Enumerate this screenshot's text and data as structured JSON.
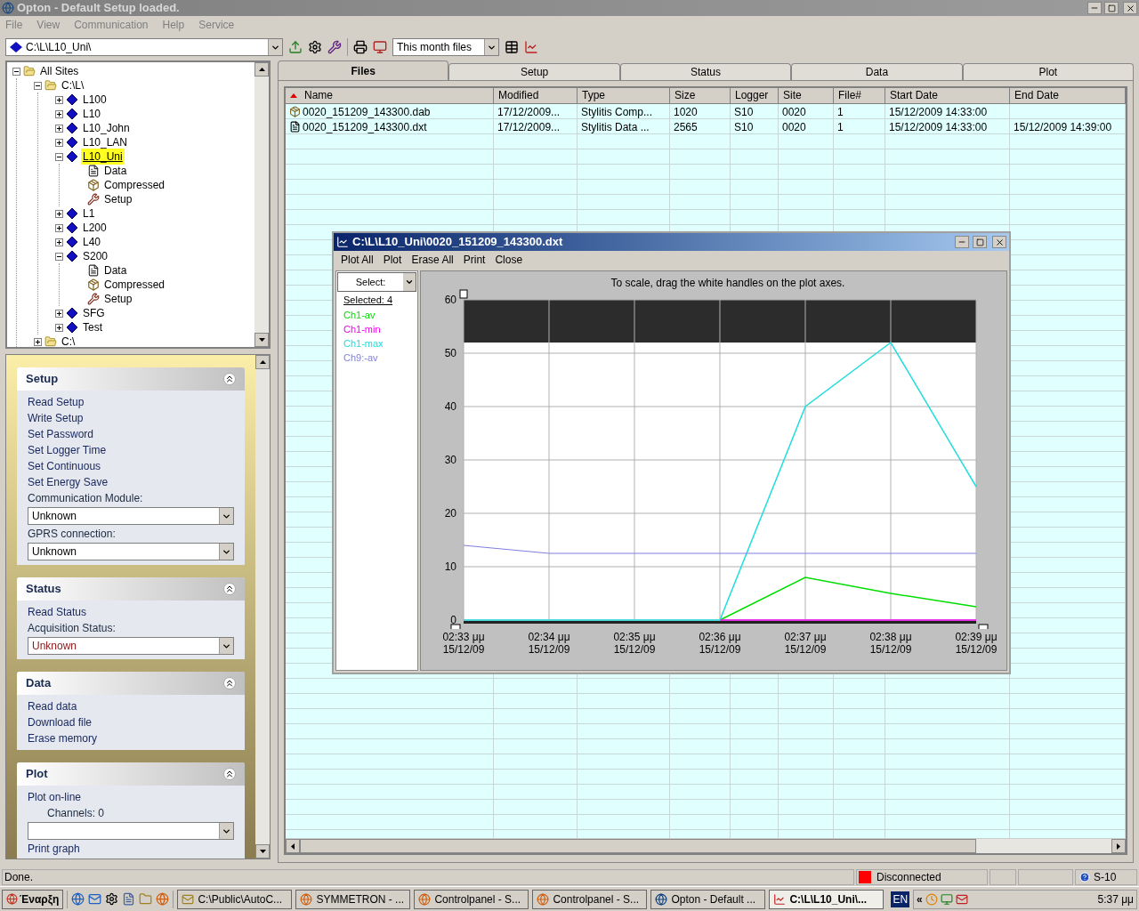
{
  "window": {
    "title": "Opton - Default Setup loaded."
  },
  "menu": [
    "File",
    "View",
    "Communication",
    "Help",
    "Service"
  ],
  "toolbar": {
    "path": "C:\\L\\L10_Uni\\",
    "filter": "This month files"
  },
  "tree": [
    {
      "label": "All Sites",
      "kind": "folder",
      "expanded": true,
      "selected": false,
      "children": [
        {
          "label": "C:\\L\\",
          "kind": "folder",
          "expanded": true,
          "selected": false,
          "children": [
            {
              "label": "L100",
              "kind": "logger",
              "expanded": false,
              "selected": false
            },
            {
              "label": "L10",
              "kind": "logger",
              "expanded": false,
              "selected": false
            },
            {
              "label": "L10_John",
              "kind": "logger",
              "expanded": false,
              "selected": false
            },
            {
              "label": "L10_LAN",
              "kind": "logger",
              "expanded": false,
              "selected": false
            },
            {
              "label": "L10_Uni",
              "kind": "logger",
              "expanded": true,
              "selected": true,
              "children": [
                {
                  "label": "Data",
                  "kind": "data",
                  "selected": false
                },
                {
                  "label": "Compressed",
                  "kind": "compressed",
                  "selected": false
                },
                {
                  "label": "Setup",
                  "kind": "setup",
                  "selected": false
                }
              ]
            },
            {
              "label": "L1",
              "kind": "logger",
              "expanded": false,
              "selected": false
            },
            {
              "label": "L200",
              "kind": "logger",
              "expanded": false,
              "selected": false
            },
            {
              "label": "L40",
              "kind": "logger",
              "expanded": false,
              "selected": false
            },
            {
              "label": "S200",
              "kind": "logger",
              "expanded": true,
              "selected": false,
              "children": [
                {
                  "label": "Data",
                  "kind": "data",
                  "selected": false
                },
                {
                  "label": "Compressed",
                  "kind": "compressed",
                  "selected": false
                },
                {
                  "label": "Setup",
                  "kind": "setup",
                  "selected": false
                }
              ]
            },
            {
              "label": "SFG",
              "kind": "logger",
              "expanded": false,
              "selected": false
            },
            {
              "label": "Test",
              "kind": "logger",
              "expanded": false,
              "selected": false
            }
          ]
        },
        {
          "label": "C:\\",
          "kind": "folder",
          "expanded": false,
          "selected": false
        }
      ]
    }
  ],
  "task_pane": [
    {
      "title": "Setup",
      "items": [
        {
          "kind": "link",
          "text": "Read Setup"
        },
        {
          "kind": "link",
          "text": "Write Setup"
        },
        {
          "kind": "link",
          "text": "Set Password"
        },
        {
          "kind": "link",
          "text": "Set Logger Time"
        },
        {
          "kind": "link",
          "text": "Set Continuous"
        },
        {
          "kind": "link",
          "text": "Set Energy Save"
        },
        {
          "kind": "label",
          "text": "Communication Module:"
        },
        {
          "kind": "dropdown",
          "text": "Unknown",
          "warning": false
        },
        {
          "kind": "label",
          "text": "GPRS connection:"
        },
        {
          "kind": "dropdown",
          "text": "Unknown",
          "warning": false
        }
      ]
    },
    {
      "title": "Status",
      "items": [
        {
          "kind": "link",
          "text": "Read Status"
        },
        {
          "kind": "label",
          "text": "Acquisition Status:"
        },
        {
          "kind": "dropdown",
          "text": "Unknown",
          "warning": true
        }
      ]
    },
    {
      "title": "Data",
      "items": [
        {
          "kind": "link",
          "text": "Read data"
        },
        {
          "kind": "link",
          "text": "Download file"
        },
        {
          "kind": "link",
          "text": "Erase memory"
        }
      ]
    },
    {
      "title": "Plot",
      "items": [
        {
          "kind": "link",
          "text": "Plot on-line"
        },
        {
          "kind": "sublabel",
          "text": "Channels: 0"
        },
        {
          "kind": "empty-dropdown"
        },
        {
          "kind": "link",
          "text": "Print graph"
        }
      ]
    }
  ],
  "tabs": [
    {
      "label": "Files",
      "selected": true
    },
    {
      "label": "Setup",
      "selected": false
    },
    {
      "label": "Status",
      "selected": false
    },
    {
      "label": "Data",
      "selected": false
    },
    {
      "label": "Plot",
      "selected": false
    }
  ],
  "files_table": {
    "columns": [
      "Name",
      "Modified",
      "Type",
      "Size",
      "Logger",
      "Site",
      "File#",
      "Start Date",
      "End Date"
    ],
    "rows": [
      {
        "kind": "compressed",
        "cells": [
          "0020_151209_143300.dab",
          "17/12/2009...",
          "Stylitis Comp...",
          "1020",
          "S10",
          "0020",
          "1",
          "15/12/2009 14:33:00",
          ""
        ]
      },
      {
        "kind": "data",
        "cells": [
          "0020_151209_143300.dxt",
          "17/12/2009...",
          "Stylitis Data ...",
          "2565",
          "S10",
          "0020",
          "1",
          "15/12/2009 14:33:00",
          "15/12/2009 14:39:00"
        ]
      }
    ]
  },
  "plot_window": {
    "title": "C:\\L\\L10_Uni\\0020_151209_143300.dxt",
    "menu": [
      "Plot All",
      "Plot",
      "Erase All",
      "Print",
      "Close"
    ],
    "select_label": "Select:",
    "selected_count": "Selected: 4",
    "hint": "To scale, drag the white handles on the plot axes.",
    "chart_data": {
      "type": "line",
      "categories": [
        "02:33 μμ\n15/12/09",
        "02:34 μμ\n15/12/09",
        "02:35 μμ\n15/12/09",
        "02:36 μμ\n15/12/09",
        "02:37 μμ\n15/12/09",
        "02:38 μμ\n15/12/09",
        "02:39 μμ\n15/12/09"
      ],
      "ylim": [
        0,
        60
      ],
      "grid": true,
      "bands": [
        {
          "axis": "y",
          "from": 52,
          "to": 60,
          "color": "#2c2c2c"
        }
      ],
      "yticks": [
        0,
        10,
        20,
        30,
        40,
        50,
        60
      ],
      "series": [
        {
          "name": "Ch1-av",
          "color": "#00dd00",
          "values": [
            null,
            null,
            null,
            0,
            8,
            5,
            2.5
          ]
        },
        {
          "name": "Ch1-min",
          "color": "#ee00ee",
          "values": [
            null,
            null,
            null,
            0,
            0,
            0,
            0
          ]
        },
        {
          "name": "Ch1-max",
          "color": "#22dddd",
          "values": [
            0,
            0,
            0,
            0,
            40,
            52,
            25
          ]
        },
        {
          "name": "Ch9:-av",
          "color": "#8080e0",
          "values": [
            14,
            12.5,
            12.5,
            12.5,
            12.5,
            12.5,
            12.5
          ]
        }
      ]
    }
  },
  "status_bar": {
    "message": "Done.",
    "connection": "Disconnected",
    "device": "S-10"
  },
  "taskbar": {
    "start": "Έναρξη",
    "tasks": [
      {
        "label": "C:\\Public\\AutoC...",
        "kind": "app",
        "selected": false
      },
      {
        "label": "SYMMETRON - ...",
        "kind": "browser",
        "selected": false
      },
      {
        "label": "Controlpanel - S...",
        "kind": "browser",
        "selected": false
      },
      {
        "label": "Controlpanel - S...",
        "kind": "browser",
        "selected": false
      },
      {
        "label": "Opton - Default ...",
        "kind": "globe",
        "selected": false
      },
      {
        "label": "C:\\L\\L10_Uni\\...",
        "kind": "chart",
        "selected": true
      }
    ],
    "language": "EN",
    "overflow": "«",
    "clock": "5:37 μμ"
  }
}
